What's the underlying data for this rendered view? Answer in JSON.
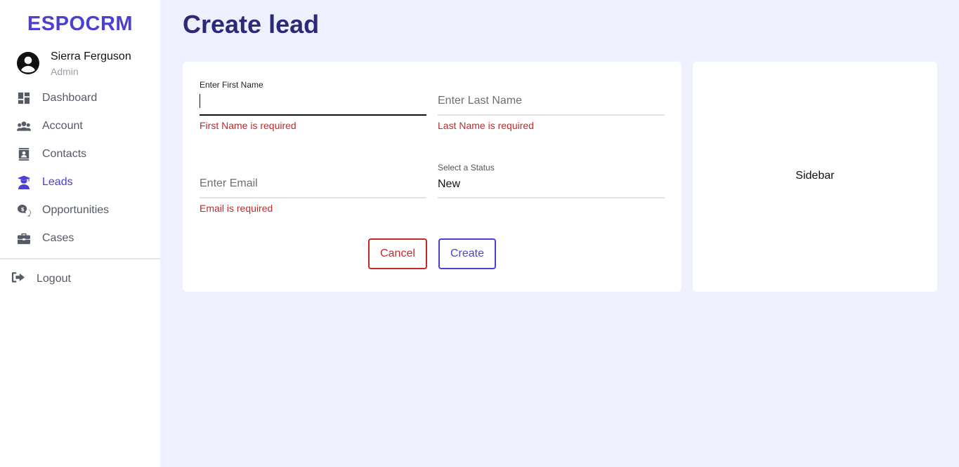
{
  "brand": "ESPOCRM",
  "user": {
    "name": "Sierra Ferguson",
    "role": "Admin"
  },
  "nav": {
    "items": [
      {
        "label": "Dashboard",
        "icon": "dashboard-icon"
      },
      {
        "label": "Account",
        "icon": "people-icon"
      },
      {
        "label": "Contacts",
        "icon": "contacts-icon"
      },
      {
        "label": "Leads",
        "icon": "graduate-icon",
        "active": true
      },
      {
        "label": "Opportunities",
        "icon": "money-chat-icon"
      },
      {
        "label": "Cases",
        "icon": "briefcase-icon"
      }
    ],
    "logout": "Logout"
  },
  "page": {
    "title": "Create lead"
  },
  "form": {
    "first_name": {
      "label": "Enter First Name",
      "value": "",
      "error": "First Name is required"
    },
    "last_name": {
      "placeholder": "Enter Last Name",
      "value": "",
      "error": "Last Name is required"
    },
    "email": {
      "placeholder": "Enter Email",
      "value": "",
      "error": "Email is required"
    },
    "status": {
      "label": "Select a Status",
      "value": "New"
    },
    "cancel_label": "Cancel",
    "create_label": "Create"
  },
  "sidebar_panel": {
    "label": "Sidebar"
  },
  "colors": {
    "accent": "#4b3fd6",
    "error": "#c62828",
    "title": "#2c2a78",
    "background": "#eef1fd"
  }
}
